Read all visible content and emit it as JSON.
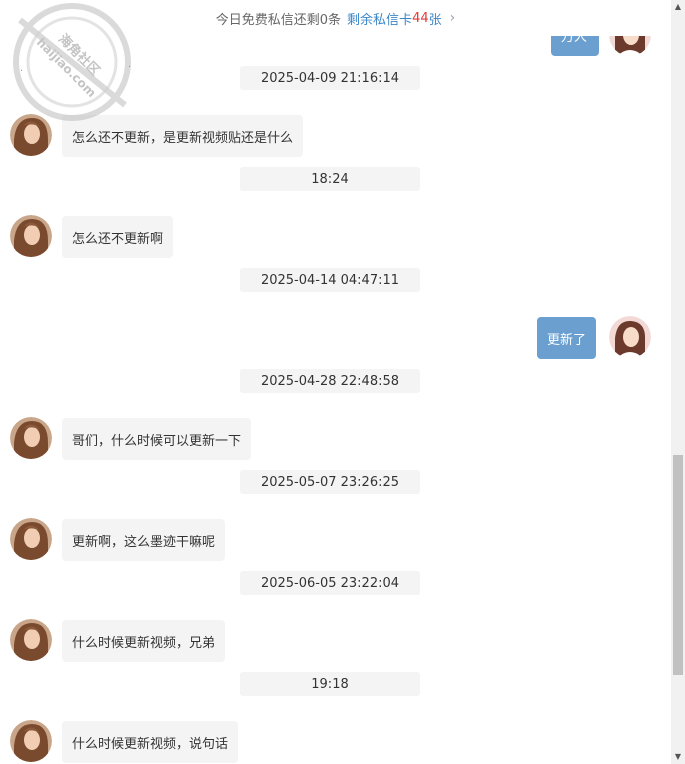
{
  "banner": {
    "free_quota": "今日免费私信还剩0条",
    "buy_prefix": "剩余私信卡",
    "buy_count": "44",
    "buy_suffix": "张",
    "chevron": "›"
  },
  "watermark": {
    "text1": "海角社区",
    "text2": "haijiao.com"
  },
  "top_partial_bubble": "万人",
  "messages": [
    {
      "time": "2025-04-09 21:16:14",
      "side": "left",
      "text": "怎么还不更新，是更新视频贴还是什么"
    },
    {
      "time": "18:24",
      "side": "left",
      "text": "怎么还不更新啊"
    },
    {
      "time": "2025-04-14 04:47:11",
      "side": "right",
      "text": "更新了"
    },
    {
      "time": "2025-04-28 22:48:58",
      "side": "left",
      "text": "哥们，什么时候可以更新一下"
    },
    {
      "time": "2025-05-07 23:26:25",
      "side": "left",
      "text": "更新啊，这么墨迹干嘛呢"
    },
    {
      "time": "2025-06-05 23:22:04",
      "side": "left",
      "text": "什么时候更新视频，兄弟"
    },
    {
      "time": "19:18",
      "side": "left",
      "text": "什么时候更新视频，说句话"
    }
  ],
  "colors": {
    "accent_link": "#3b87c9",
    "count_red": "#e53935",
    "bubble_self": "#6b9fcf",
    "bubble_other": "#f4f4f4"
  }
}
